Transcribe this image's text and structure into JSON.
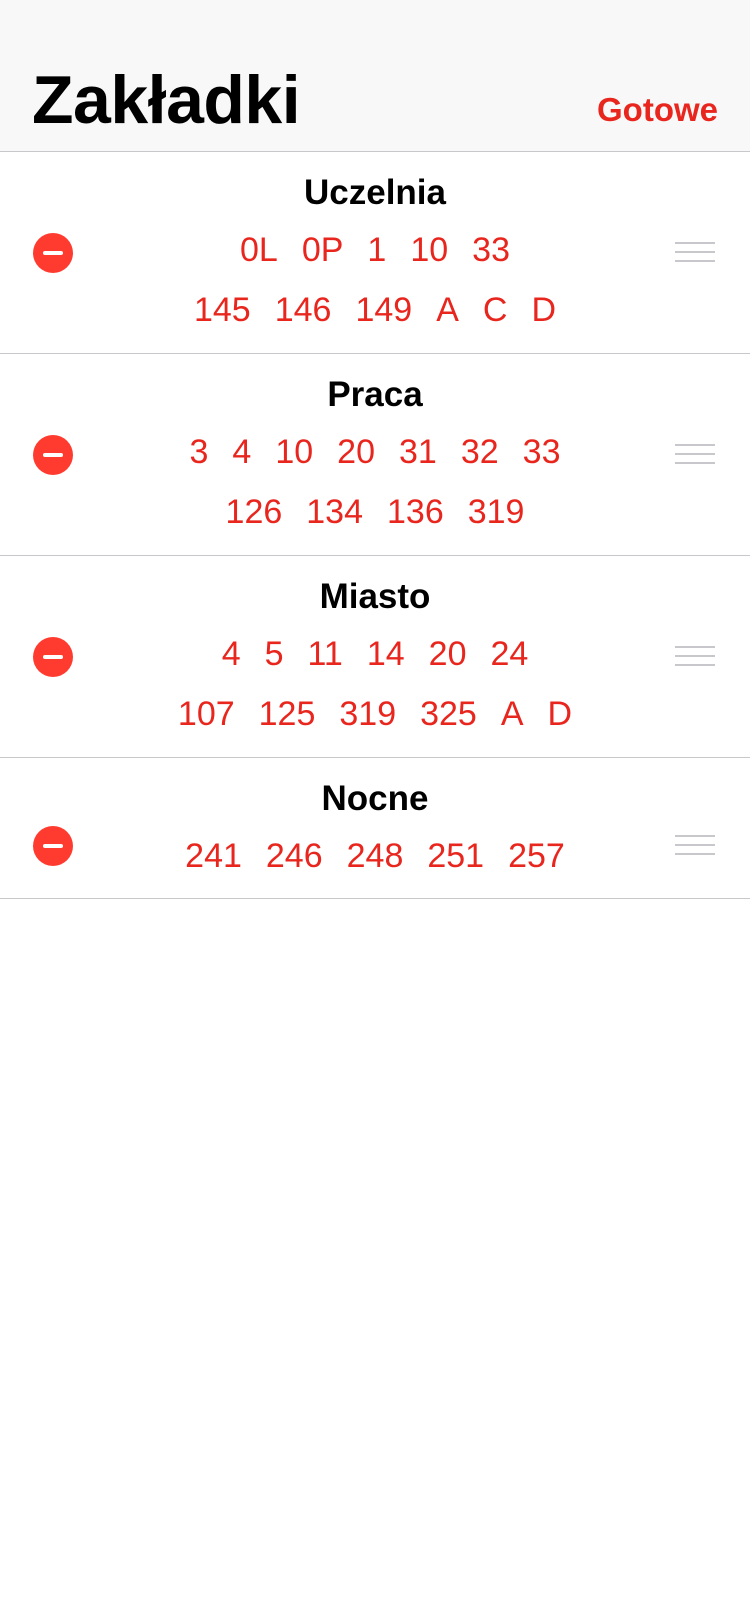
{
  "header": {
    "title": "Zakładki",
    "done_label": "Gotowe"
  },
  "colors": {
    "accent": "#e8261e",
    "delete": "#ff3b30",
    "separator": "#c8c8cc"
  },
  "icons": {
    "delete": "minus-circle-icon",
    "reorder": "reorder-handle-icon"
  },
  "bookmarks": [
    {
      "title": "Uczelnia",
      "lines": [
        [
          "0L",
          "0P",
          "1",
          "10",
          "33"
        ],
        [
          "145",
          "146",
          "149",
          "A",
          "C",
          "D"
        ]
      ]
    },
    {
      "title": "Praca",
      "lines": [
        [
          "3",
          "4",
          "10",
          "20",
          "31",
          "32",
          "33"
        ],
        [
          "126",
          "134",
          "136",
          "319"
        ]
      ]
    },
    {
      "title": "Miasto",
      "lines": [
        [
          "4",
          "5",
          "11",
          "14",
          "20",
          "24"
        ],
        [
          "107",
          "125",
          "319",
          "325",
          "A",
          "D"
        ]
      ]
    },
    {
      "title": "Nocne",
      "lines": [
        [
          "241",
          "246",
          "248",
          "251",
          "257"
        ]
      ]
    }
  ]
}
